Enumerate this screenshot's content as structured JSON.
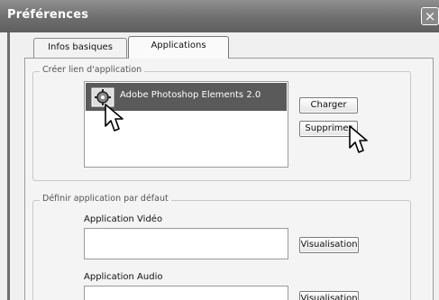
{
  "window": {
    "title": "Préférences",
    "close_glyph": "×"
  },
  "tabs": [
    {
      "label": "Infos basiques",
      "selected": false
    },
    {
      "label": "Applications",
      "selected": true
    }
  ],
  "group_create": {
    "legend": "Créer lien d'application",
    "apps": [
      {
        "label": "Adobe Photoshop Elements 2.0",
        "icon": "gear-app-icon",
        "selected": true
      }
    ],
    "buttons": {
      "load": "Charger",
      "remove": "Supprimer"
    }
  },
  "group_default": {
    "legend": "Définir application par défaut",
    "video_label": "Application Vidéo",
    "audio_label": "Application Audio",
    "view_button": "Visualisation",
    "video_value": "",
    "audio_value": ""
  },
  "colors": {
    "titlebar": "#6e6e6e",
    "selection": "#5a5a5a",
    "panel": "#f4f4f4"
  }
}
